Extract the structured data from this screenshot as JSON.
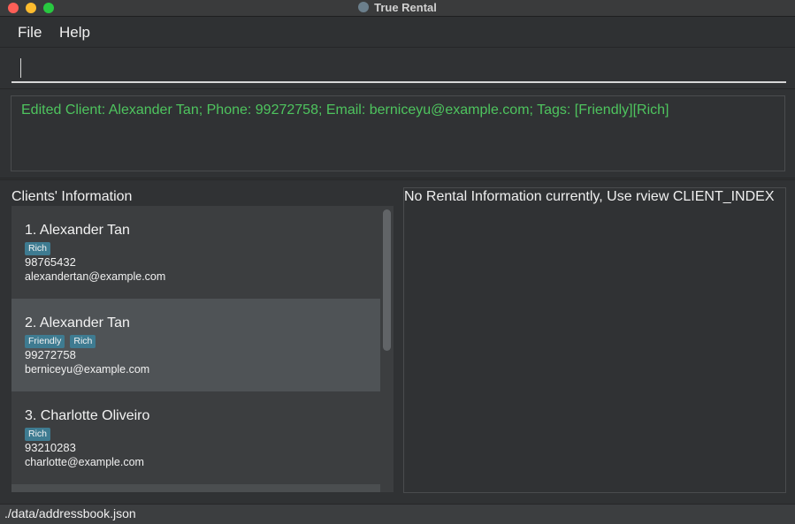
{
  "window": {
    "title": "True Rental",
    "app_icon": "magnifier-app-icon"
  },
  "menubar": {
    "items": [
      {
        "label": "File"
      },
      {
        "label": "Help"
      }
    ]
  },
  "command": {
    "value": "",
    "placeholder": ""
  },
  "result": {
    "message": "Edited Client: Alexander Tan; Phone: 99272758; Email: berniceyu@example.com; Tags: [Friendly][Rich]",
    "color": "#4ec45e"
  },
  "clients": {
    "title": "Clients' Information",
    "items": [
      {
        "name": "1. Alexander Tan",
        "tags": [
          "Rich"
        ],
        "phone": "98765432",
        "email": "alexandertan@example.com"
      },
      {
        "name": "2. Alexander Tan",
        "tags": [
          "Friendly",
          "Rich"
        ],
        "phone": "99272758",
        "email": "berniceyu@example.com"
      },
      {
        "name": "3. Charlotte Oliveiro",
        "tags": [
          "Rich"
        ],
        "phone": "93210283",
        "email": "charlotte@example.com"
      }
    ]
  },
  "rental": {
    "message": "No Rental Information currently, Use rview CLIENT_INDEX"
  },
  "status": {
    "path": "./data/addressbook.json"
  },
  "colors": {
    "tag_bg": "#3e7b91",
    "selected_row": "#4f5356",
    "background": "#303234"
  }
}
